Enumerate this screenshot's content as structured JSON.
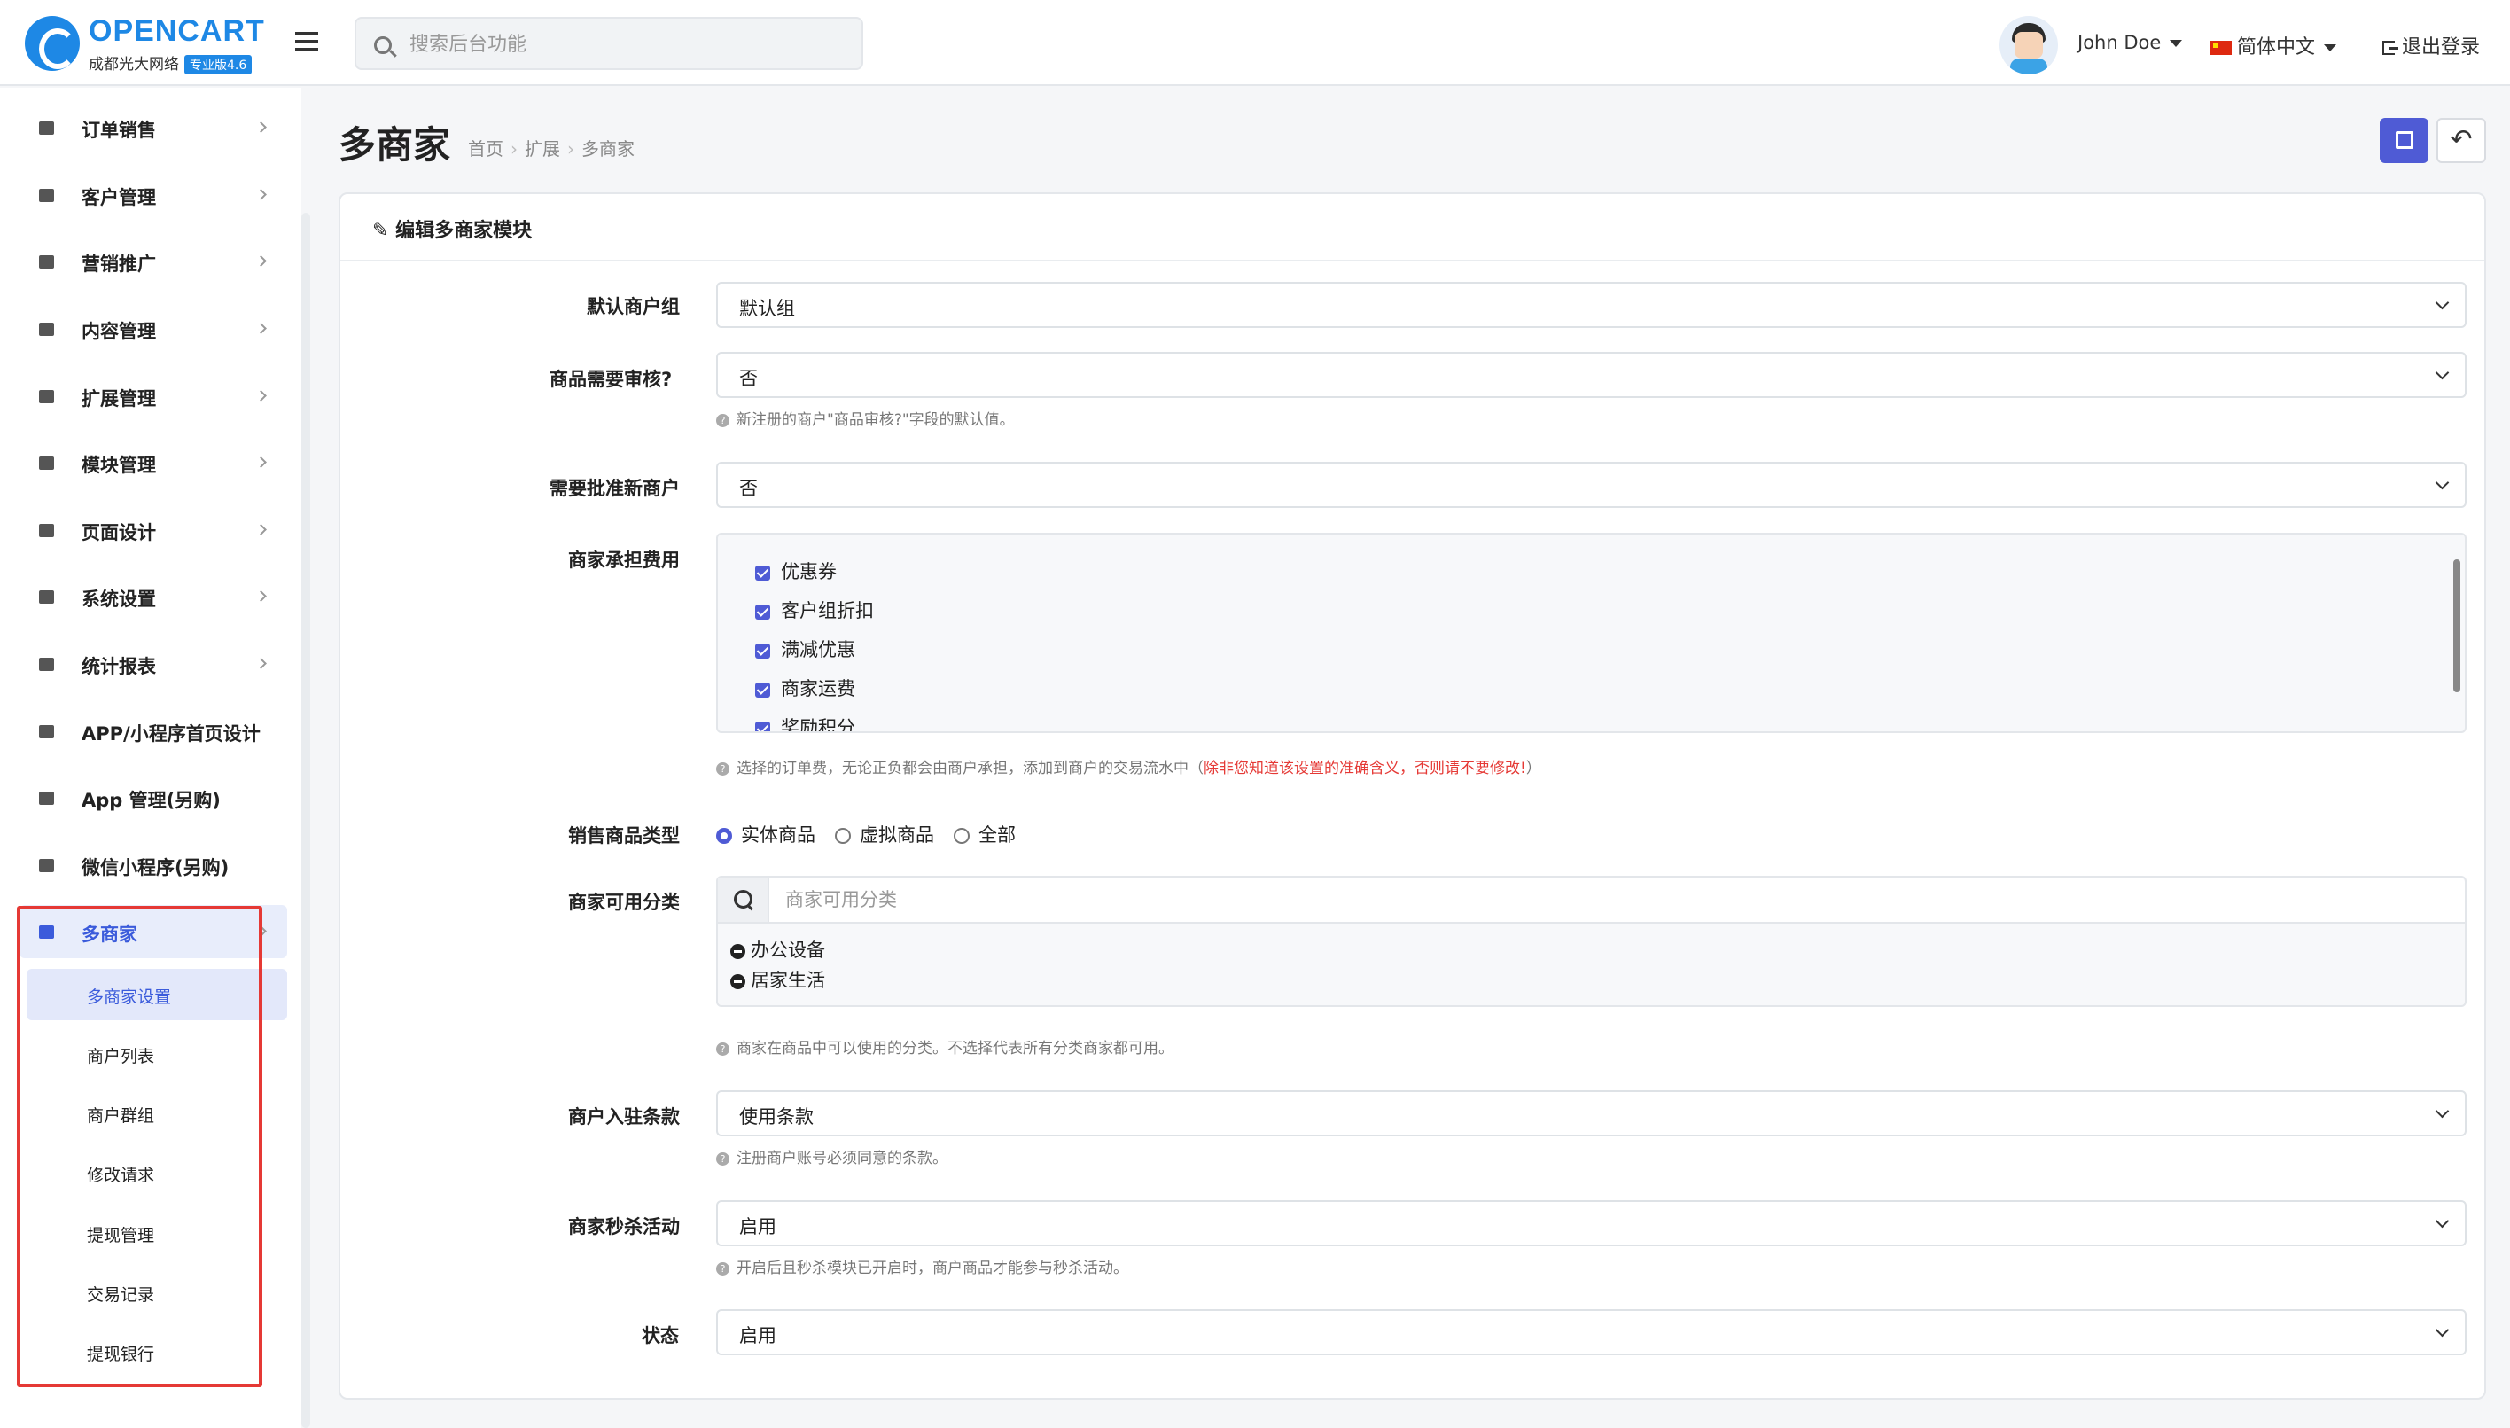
{
  "app": {
    "brand": "OPENCART",
    "subtitle": "成都光大网络",
    "edition": "专业版4.6"
  },
  "header": {
    "search_placeholder": "搜索后台功能",
    "user_name": "John Doe",
    "language": "简体中文",
    "logout": "退出登录"
  },
  "sidebar": {
    "items": [
      {
        "label": "订单销售",
        "icon": "cart-icon"
      },
      {
        "label": "客户管理",
        "icon": "user-icon"
      },
      {
        "label": "营销推广",
        "icon": "share-icon"
      },
      {
        "label": "内容管理",
        "icon": "book-icon"
      },
      {
        "label": "扩展管理",
        "icon": "puzzle-icon"
      },
      {
        "label": "模块管理",
        "icon": "cube-icon"
      },
      {
        "label": "页面设计",
        "icon": "monitor-icon"
      },
      {
        "label": "系统设置",
        "icon": "gear-icon"
      },
      {
        "label": "统计报表",
        "icon": "bar-chart-icon"
      },
      {
        "label": "APP/小程序首页设计",
        "icon": "mobile-icon"
      },
      {
        "label": "App 管理(另购)",
        "icon": "apple-icon"
      },
      {
        "label": "微信小程序(另购)",
        "icon": "wechat-icon"
      },
      {
        "label": "多商家",
        "icon": "dropbox-icon"
      }
    ],
    "sub_items": [
      "多商家设置",
      "商户列表",
      "商户群组",
      "修改请求",
      "提现管理",
      "交易记录",
      "提现银行"
    ]
  },
  "page": {
    "title": "多商家",
    "breadcrumb": [
      "首页",
      "扩展",
      "多商家"
    ],
    "card_title": "编辑多商家模块"
  },
  "form": {
    "default_group": {
      "label": "默认商户组",
      "value": "默认组"
    },
    "product_review": {
      "label": "商品需要审核?",
      "value": "否",
      "help": "新注册的商户\"商品审核?\"字段的默认值。"
    },
    "approve_new": {
      "label": "需要批准新商户",
      "value": "否"
    },
    "fees": {
      "label": "商家承担费用",
      "options": [
        "优惠券",
        "客户组折扣",
        "满减优惠",
        "商家运费",
        "奖励积分"
      ],
      "help": "选择的订单费，无论正负都会由商户承担，添加到商户的交易流水中（",
      "help_warn": "除非您知道该设置的准确含义，否则请不要修改!",
      "help_end": "）"
    },
    "product_type": {
      "label": "销售商品类型",
      "options": [
        "实体商品",
        "虚拟商品",
        "全部"
      ],
      "selected": "实体商品"
    },
    "categories": {
      "label": "商家可用分类",
      "placeholder": "商家可用分类",
      "items": [
        "办公设备",
        "居家生活"
      ],
      "help": "商家在商品中可以使用的分类。不选择代表所有分类商家都可用。"
    },
    "terms": {
      "label": "商户入驻条款",
      "value": "使用条款",
      "help": "注册商户账号必须同意的条款。"
    },
    "seckill": {
      "label": "商家秒杀活动",
      "value": "启用",
      "help": "开启后且秒杀模块已开启时，商户商品才能参与秒杀活动。"
    },
    "status": {
      "label": "状态",
      "value": "启用"
    }
  },
  "colors": {
    "brand": "#1e88e5",
    "accent": "#4f5bd5",
    "highlight": "#e53935"
  }
}
